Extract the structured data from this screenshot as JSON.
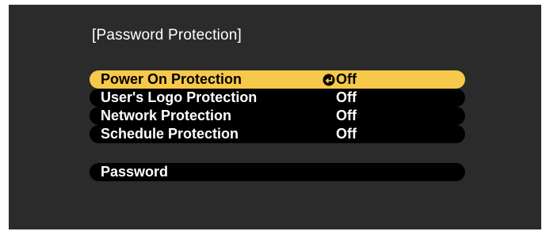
{
  "menu": {
    "title": "[Password Protection]",
    "items": [
      {
        "label": "Power On Protection",
        "value": "Off",
        "selected": true,
        "enter_icon": "enter-return-icon"
      },
      {
        "label": "User's Logo Protection",
        "value": "Off",
        "selected": false
      },
      {
        "label": "Network Protection",
        "value": "Off",
        "selected": false
      },
      {
        "label": "Schedule Protection",
        "value": "Off",
        "selected": false
      }
    ],
    "password_label": "Password"
  },
  "colors": {
    "screen_bg": "#2b2b2b",
    "item_bg": "#000000",
    "selected_bg": "#f7c94a",
    "text": "#ffffff",
    "selected_text": "#000000"
  }
}
